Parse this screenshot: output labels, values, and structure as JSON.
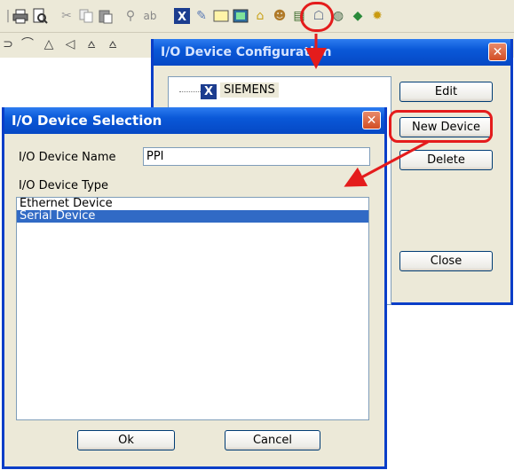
{
  "toolbar": {
    "icons": [
      "print-icon",
      "print-preview-icon",
      "cut-icon",
      "copy-icon",
      "paste-icon",
      "find-icon",
      "replace-icon",
      "plc-icon",
      "script-icon",
      "window-icon",
      "io-device-icon",
      "alarm-icon",
      "user-icon",
      "report-icon",
      "network-icon",
      "database-icon",
      "module-icon",
      "settings-icon"
    ]
  },
  "drawbar": {
    "icons": [
      "polyline-icon",
      "arc-icon",
      "polygon-icon",
      "curve-icon",
      "shape-icon",
      "shape-alt-icon"
    ]
  },
  "config_window": {
    "title": "I/O Device Configuration",
    "close_glyph": "✕",
    "tree": {
      "item_label": "SIEMENS",
      "item_icon_glyph": "X"
    },
    "buttons": {
      "edit": "Edit",
      "new_device": "New Device",
      "delete": "Delete",
      "close": "Close"
    }
  },
  "selection_dialog": {
    "title": "I/O Device Selection",
    "close_glyph": "✕",
    "name_label": "I/O Device Name",
    "name_value": "PPI",
    "type_label": "I/O Device Type",
    "device_types": [
      "Ethernet Device",
      "Serial Device"
    ],
    "selected_index": 1,
    "ok_label": "Ok",
    "cancel_label": "Cancel"
  },
  "colors": {
    "title_bar": "#0a58d8",
    "highlight": "#e41c1c",
    "selection": "#316ac5"
  }
}
